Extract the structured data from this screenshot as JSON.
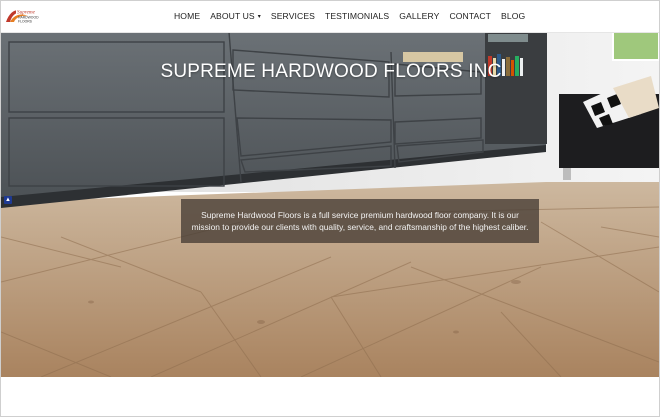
{
  "header": {
    "logo_text": "Supreme Hardwood Floors",
    "nav": [
      {
        "label": "HOME"
      },
      {
        "label": "ABOUT US",
        "has_dropdown": true
      },
      {
        "label": "SERVICES"
      },
      {
        "label": "TESTIMONIALS"
      },
      {
        "label": "GALLERY"
      },
      {
        "label": "CONTACT"
      },
      {
        "label": "BLOG"
      }
    ]
  },
  "hero": {
    "title": "SUPREME HARDWOOD FLOORS INC",
    "description": "Supreme Hardwood Floors is a full service premium hardwood floor company. It is our mission to provide our clients with quality, service, and craftsmanship of the highest caliber."
  },
  "colors": {
    "accent": "#c0392b",
    "overlay": "#463c34",
    "cabinet": "#5b6166",
    "floor": "#b99a7a"
  }
}
